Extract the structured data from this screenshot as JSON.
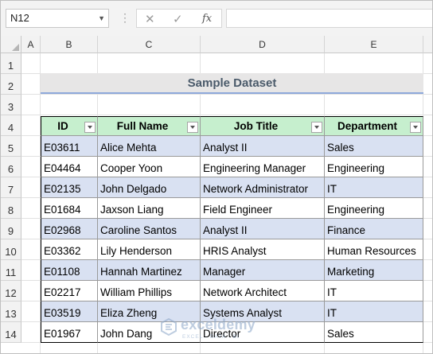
{
  "formula_bar": {
    "name_box": "N12",
    "fx_label": "fx",
    "cancel_symbol": "✕",
    "enter_symbol": "✓",
    "formula": ""
  },
  "columns": [
    "A",
    "B",
    "C",
    "D",
    "E"
  ],
  "rows": [
    "1",
    "2",
    "3",
    "4",
    "5",
    "6",
    "7",
    "8",
    "9",
    "10",
    "11",
    "12",
    "13",
    "14"
  ],
  "title": "Sample Dataset",
  "table": {
    "headers": [
      "ID",
      "Full Name",
      "Job Title",
      "Department"
    ],
    "rows": [
      [
        "E03611",
        "Alice Mehta",
        "Analyst II",
        "Sales"
      ],
      [
        "E04464",
        "Cooper Yoon",
        "Engineering Manager",
        "Engineering"
      ],
      [
        "E02135",
        "John Delgado",
        "Network Administrator",
        "IT"
      ],
      [
        "E01684",
        "Jaxson Liang",
        "Field Engineer",
        "Engineering"
      ],
      [
        "E02968",
        "Caroline Santos",
        "Analyst II",
        "Finance"
      ],
      [
        "E03362",
        "Lily Henderson",
        "HRIS Analyst",
        "Human Resources"
      ],
      [
        "E01108",
        "Hannah Martinez",
        "Manager",
        "Marketing"
      ],
      [
        "E02217",
        "William Phillips",
        "Network Architect",
        "IT"
      ],
      [
        "E03519",
        "Eliza Zheng",
        "Systems Analyst",
        "IT"
      ],
      [
        "E01967",
        "John Dang",
        "Director",
        "Sales"
      ]
    ]
  },
  "colors": {
    "header_fill": "#c6efce",
    "band_fill": "#d9e1f2",
    "title_fill": "#e7e6e6",
    "title_underline": "#8ea9db"
  },
  "watermark": {
    "name": "exceldemy",
    "tagline": "EXCEL · DATA · BI"
  }
}
